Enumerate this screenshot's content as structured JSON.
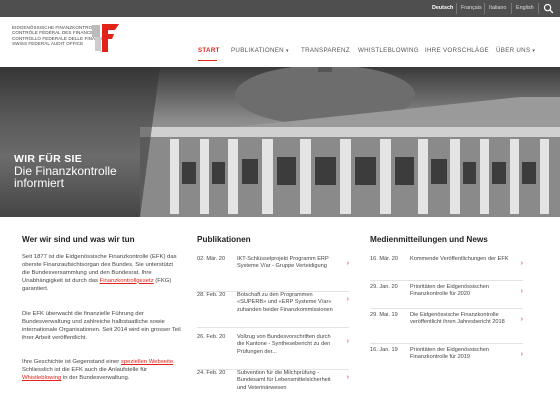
{
  "languages": [
    "Deutsch",
    "Français",
    "Italiano",
    "English"
  ],
  "logo": {
    "lines": [
      "EIDGENÖSSISCHE FINANZKONTROLLE",
      "CONTRÔLE FÉDÉRAL DES FINANCES",
      "CONTROLLO FEDERALE DELLE FINANZE",
      "SWISS FEDERAL AUDIT OFFICE"
    ]
  },
  "nav": {
    "start": "START",
    "publikationen": "PUBLIKATIONEN",
    "transparenz": "TRANSPARENZ",
    "whistleblowing": "WHISTLEBLOWING",
    "vorschlaege": "IHRE VORSCHLÄGE",
    "ueber_uns": "ÜBER UNS"
  },
  "hero": {
    "title": "WIR FÜR SIE",
    "subtitle": "Die Finanzkontrolle informiert"
  },
  "about": {
    "title": "Wer wir sind und was wir tun",
    "p1_a": "Seit 1877 ist die Eidgenössische Finanzkontrolle (EFK) das oberste Finanzaufsichtsorgan des Bundes. Sie unterstützt die Bundesversammlung und den Bundesrat. Ihre Unabhängigkeit ist durch das ",
    "p1_link": "Finanzkontrollgesetz",
    "p1_b": " (FKG) garantiert.",
    "p2": "Die EFK überwacht die finanzielle Führung der Bundesverwaltung und zahlreiche halbstaatliche sowie internationale Organisationen. Seit 2014 wird ein grosser Teil ihrer Arbeit veröffentlicht.",
    "p3_a": "Ihre Geschichte ist Gegenstand einer ",
    "p3_link1": "speziellen Webseite",
    "p3_b": ". Schliesslich ist die EFK auch die Anlaufstelle für ",
    "p3_link2": "Whistleblowing",
    "p3_c": " in der Bundesverwaltung."
  },
  "publikationen": {
    "title": "Publikationen",
    "items": [
      {
        "date": "02. Mär. 20",
        "text": "IKT-Schlüsselprojekt Programm ERP Systeme V/ar - Gruppe Verteidigung"
      },
      {
        "date": "28. Feb. 20",
        "text": "Botschaft zu den Programmen «SUPERB» und «ERP Systeme V/ar» zuhanden beider Finanzkommissionen"
      },
      {
        "date": "26. Feb. 20",
        "text": "Vollzug von Bundesvorschriften durch die Kantone - Synthesebericht zu den Prüfungen der..."
      },
      {
        "date": "24. Feb. 20",
        "text": "Subvention für die Milchprüfung - Bundesamt für Lebensmittelsicherheit und Veterinärwesen"
      }
    ]
  },
  "medien": {
    "title": "Medienmitteilungen und News",
    "items": [
      {
        "date": "16. Mär. 20",
        "text": "Kommende Veröffentlichungen der EFK"
      },
      {
        "date": "29. Jan. 20",
        "text": "Prioritäten der Eidgenössischen Finanzkontrolle für 2020"
      },
      {
        "date": "29. Mai. 19",
        "text": "Die Eidgenössische Finanzkontrolle veröffentlicht ihren Jahresbericht 2018"
      },
      {
        "date": "16. Jan. 19",
        "text": "Prioritäten der Eidgenössischen Finanzkontrolle für 2019"
      }
    ]
  },
  "colors": {
    "accent": "#e2231a",
    "topbar": "#4f4f4f"
  },
  "icons": [
    "search-icon",
    "chevron-down-icon",
    "chevron-right-icon",
    "efk-logo-mark"
  ]
}
